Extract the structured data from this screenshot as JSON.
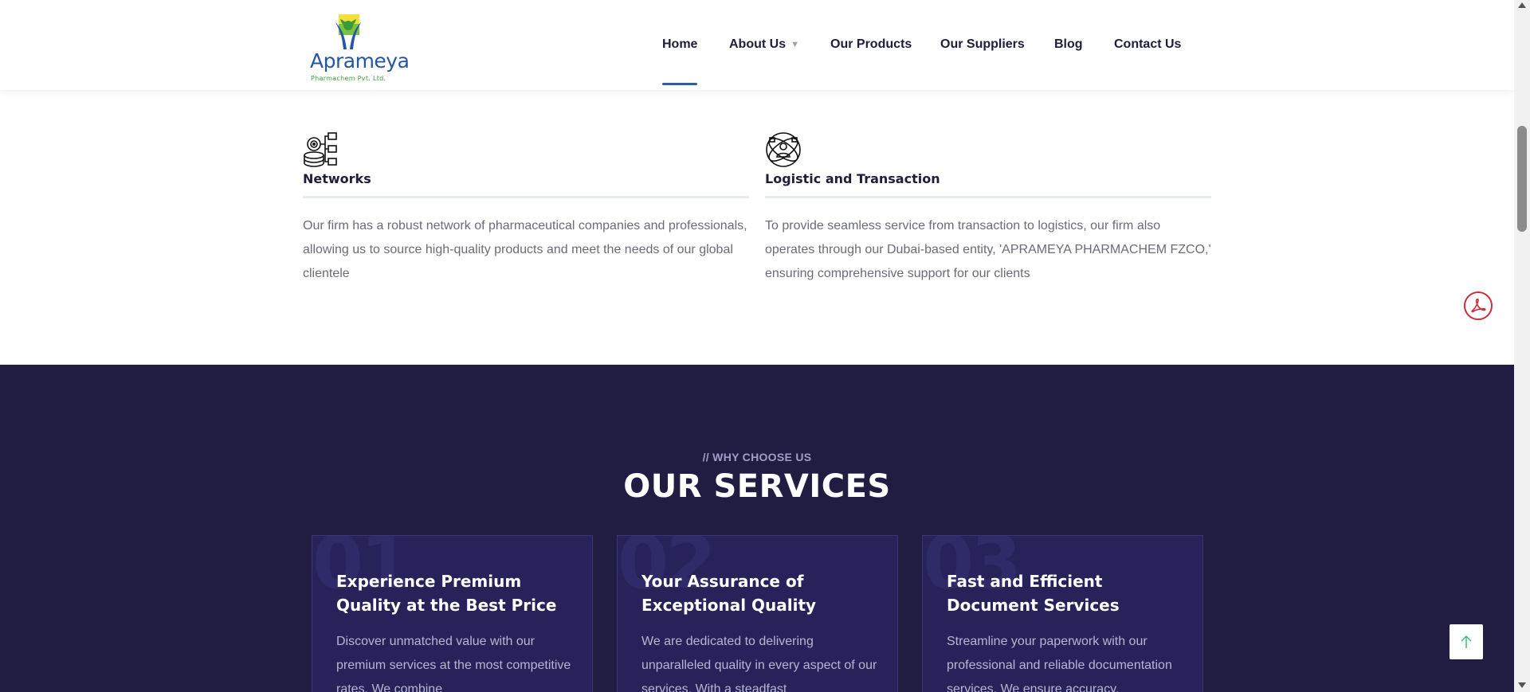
{
  "brand": {
    "name": "Aprameya",
    "tagline": "Pharmachem Pvt. Ltd."
  },
  "nav": {
    "items": [
      {
        "label": "Home",
        "active": true
      },
      {
        "label": "About Us",
        "has_dropdown": true
      },
      {
        "label": "Our Products"
      },
      {
        "label": "Our Suppliers"
      },
      {
        "label": "Blog"
      },
      {
        "label": "Contact Us"
      }
    ]
  },
  "features": [
    {
      "icon": "network-icon",
      "title": "Networks",
      "text": "Our firm has a robust network of pharmaceutical companies and professionals, allowing us to source high-quality products and meet the needs of our global clientele"
    },
    {
      "icon": "logistics-icon",
      "title": "Logistic and Transaction",
      "text": "To provide seamless service from transaction to logistics, our firm also operates through our Dubai-based entity, 'APRAMEYA PHARMACHEM FZCO,' ensuring comprehensive support for our clients"
    }
  ],
  "services": {
    "eyebrow": "// WHY CHOOSE US",
    "title": "OUR SERVICES",
    "cards": [
      {
        "number": "01",
        "title": "Experience Premium Quality at the Best Price",
        "text": "Discover unmatched value with our premium services at the most competitive rates. We combine"
      },
      {
        "number": "02",
        "title": "Your Assurance of Exceptional Quality",
        "text": "We are dedicated to delivering unparalleled quality in every aspect of our services. With a steadfast"
      },
      {
        "number": "03",
        "title": "Fast and Efficient Document Services",
        "text": "Streamline your paperwork with our professional and reliable documentation services. We ensure accuracy,"
      }
    ]
  },
  "colors": {
    "dark_section": "#211d42",
    "card_bg": "#27235a",
    "nav_active": "#2c5ea8",
    "pdf_red": "#c9303f"
  },
  "floating": {
    "pdf_icon": "pdf-icon",
    "back_to_top_icon": "arrow-up-icon"
  }
}
